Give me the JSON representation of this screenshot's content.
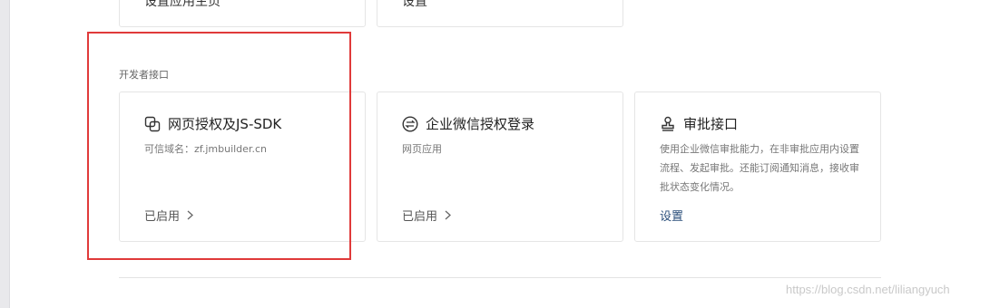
{
  "top_cards": [
    {
      "text": "设置应用主页"
    },
    {
      "text": "设置"
    }
  ],
  "section": {
    "title": "开发者接口"
  },
  "cards": [
    {
      "title": "网页授权及JS-SDK",
      "icon": "web-auth-icon",
      "desc": "可信域名：zf.jmbuilder.cn",
      "status": "已启用"
    },
    {
      "title": "企业微信授权登录",
      "icon": "wecom-login-icon",
      "desc": "网页应用",
      "status": "已启用"
    },
    {
      "title": "审批接口",
      "icon": "stamp-icon",
      "desc": "使用企业微信审批能力，在非审批应用内设置流程、发起审批。还能订阅通知消息，接收审批状态变化情况。",
      "link": "设置"
    }
  ],
  "colors": {
    "highlight": "#e03a3a",
    "link": "#2a4e7a"
  },
  "watermark": "https://blog.csdn.net/liliangyuch"
}
